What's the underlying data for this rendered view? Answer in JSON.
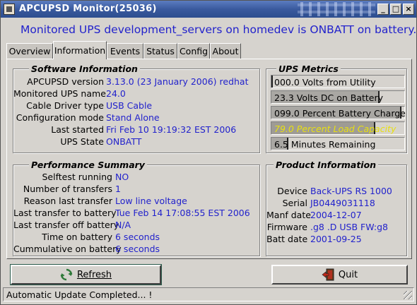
{
  "window": {
    "title": "APCUPSD Monitor(25036)",
    "buttons": {
      "minimize": "_",
      "maximize": "□",
      "close": "×"
    }
  },
  "headline": "Monitored UPS development_servers on homedev is ONBATT on battery...",
  "tabs": [
    {
      "label": "Overview",
      "active": false
    },
    {
      "label": "Information",
      "active": true
    },
    {
      "label": "Events",
      "active": false
    },
    {
      "label": "Status",
      "active": false
    },
    {
      "label": "Config",
      "active": false
    },
    {
      "label": "About",
      "active": false
    }
  ],
  "software": {
    "title": "Software Information",
    "rows": [
      {
        "label": "APCUPSD version",
        "value": "3.13.0 (23 January 2006) redhat"
      },
      {
        "label": "Monitored UPS name",
        "value": "24.0"
      },
      {
        "label": "Cable Driver type",
        "value": "USB Cable"
      },
      {
        "label": "Configuration mode",
        "value": "Stand Alone"
      },
      {
        "label": "Last started",
        "value": "Fri Feb 10 19:19:32 EST 2006"
      },
      {
        "label": "UPS State",
        "value": "ONBATT"
      }
    ]
  },
  "metrics": {
    "title": "UPS Metrics",
    "bars": [
      {
        "text": "000.0 Volts from Utility",
        "level": 0.0,
        "warn": false
      },
      {
        "text": "23.3 Volts DC on Battery",
        "level": 0.82,
        "warn": false
      },
      {
        "text": "099.0 Percent Battery Charge",
        "level": 0.99,
        "warn": false
      },
      {
        "text": "79.0 Percent Load Capacity",
        "level": 0.79,
        "warn": true
      },
      {
        "text": "6.5 Minutes Remaining",
        "level": 0.13,
        "warn": false
      }
    ]
  },
  "performance": {
    "title": "Performance Summary",
    "rows": [
      {
        "label": "Selftest running",
        "value": "NO"
      },
      {
        "label": "Number of transfers",
        "value": "1"
      },
      {
        "label": "Reason last transfer",
        "value": "Low line voltage"
      },
      {
        "label": "Last transfer to battery",
        "value": "Tue Feb 14 17:08:55 EST 2006"
      },
      {
        "label": "Last transfer off battery",
        "value": "N/A"
      },
      {
        "label": "Time on battery",
        "value": "6 seconds"
      },
      {
        "label": "Cummulative on battery",
        "value": "6 seconds"
      }
    ]
  },
  "product": {
    "title": "Product Information",
    "rows": [
      {
        "label": "Device",
        "value": "Back-UPS RS 1000"
      },
      {
        "label": "Serial",
        "value": "JB0449031118"
      },
      {
        "label": "Manf date",
        "value": "2004-12-07"
      },
      {
        "label": "Firmware",
        "value": ".g8 .D USB FW:g8"
      },
      {
        "label": "Batt date",
        "value": "2001-09-25"
      }
    ]
  },
  "buttons": {
    "refresh": {
      "label": "Refresh",
      "icon": "refresh-icon"
    },
    "quit": {
      "label": "Quit",
      "icon": "exit-door-icon"
    }
  },
  "status": "Automatic Update Completed... !",
  "colors": {
    "value_text": "#2222cc",
    "titlebar": "#3a5a9e",
    "warn_text": "#e8e010"
  }
}
